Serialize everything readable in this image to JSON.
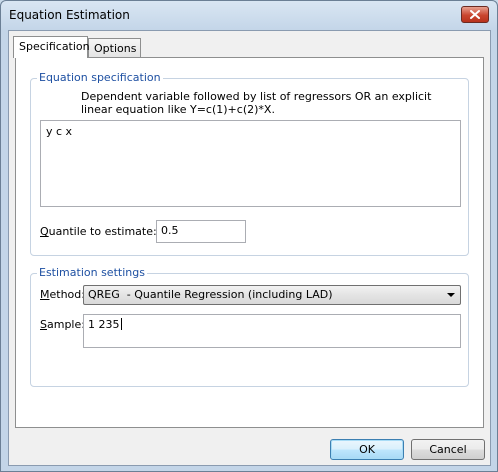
{
  "window": {
    "title": "Equation Estimation"
  },
  "tabs": [
    {
      "label": "Specification",
      "active": true
    },
    {
      "label": "Options",
      "active": false
    }
  ],
  "equation_spec": {
    "group_label": "Equation specification",
    "description_line1": "Dependent variable followed by list of regressors OR an explicit",
    "description_line2": "linear equation like Y=c(1)+c(2)*X.",
    "equation_text": "y c x",
    "quantile_label_mnemonic": "Q",
    "quantile_label_rest": "uantile to estimate:",
    "quantile_value": "0.5"
  },
  "estimation_settings": {
    "group_label": "Estimation settings",
    "method_label_mnemonic": "M",
    "method_label_rest": "ethod:",
    "method_value": "QREG  - Quantile Regression (including LAD)",
    "sample_label_mnemonic": "S",
    "sample_label_rest": "ample:",
    "sample_value": "1 235"
  },
  "buttons": {
    "ok": "OK",
    "cancel": "Cancel"
  }
}
